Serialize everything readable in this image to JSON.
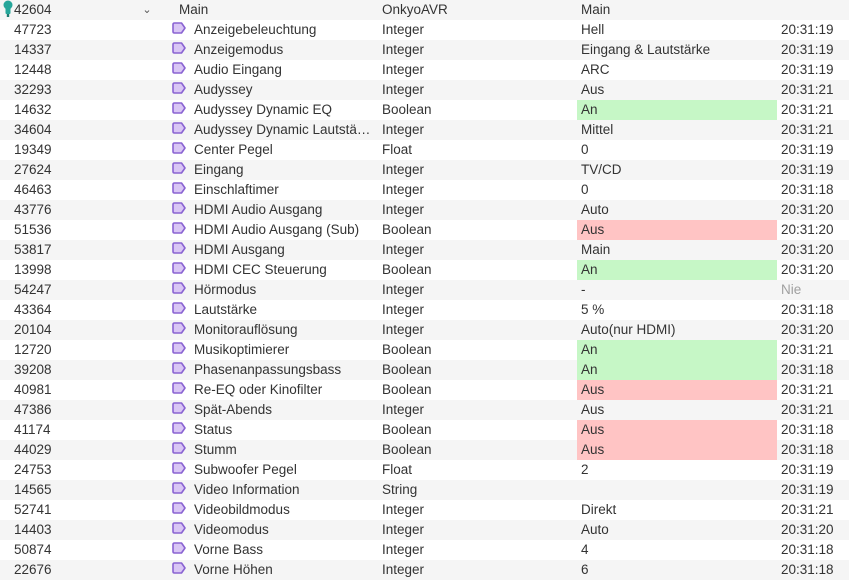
{
  "colors": {
    "accent": "#8a63d2",
    "true_bg": "#c6f7c6",
    "false_bg": "#ffc4c4",
    "instance_icon": "#26a69a"
  },
  "icons": {
    "expander": "chevron-down-icon",
    "instance": "instance-icon",
    "variable": "variable-icon"
  },
  "parent": {
    "id": "42604",
    "expander_glyph": "⌄",
    "name": "Main",
    "type": "OnkyoAVR",
    "value": "Main"
  },
  "rows": [
    {
      "id": "47723",
      "name": "Anzeigebeleuchtung",
      "type": "Integer",
      "value": "Hell",
      "status": "",
      "time": "20:31:19"
    },
    {
      "id": "14337",
      "name": "Anzeigemodus",
      "type": "Integer",
      "value": "Eingang & Lautstärke",
      "status": "",
      "time": "20:31:19"
    },
    {
      "id": "12448",
      "name": "Audio Eingang",
      "type": "Integer",
      "value": "ARC",
      "status": "",
      "time": "20:31:19"
    },
    {
      "id": "32293",
      "name": "Audyssey",
      "type": "Integer",
      "value": "Aus",
      "status": "",
      "time": "20:31:21"
    },
    {
      "id": "14632",
      "name": "Audyssey Dynamic EQ",
      "type": "Boolean",
      "value": "An",
      "status": "green",
      "time": "20:31:21"
    },
    {
      "id": "34604",
      "name": "Audyssey Dynamic Lautstä…",
      "type": "Integer",
      "value": "Mittel",
      "status": "",
      "time": "20:31:21"
    },
    {
      "id": "19349",
      "name": "Center Pegel",
      "type": "Float",
      "value": "0",
      "status": "",
      "time": "20:31:19"
    },
    {
      "id": "27624",
      "name": "Eingang",
      "type": "Integer",
      "value": "TV/CD",
      "status": "",
      "time": "20:31:19"
    },
    {
      "id": "46463",
      "name": "Einschlaftimer",
      "type": "Integer",
      "value": "0",
      "status": "",
      "time": "20:31:18"
    },
    {
      "id": "43776",
      "name": "HDMI Audio Ausgang",
      "type": "Integer",
      "value": "Auto",
      "status": "",
      "time": "20:31:20"
    },
    {
      "id": "51536",
      "name": "HDMI Audio Ausgang (Sub)",
      "type": "Boolean",
      "value": "Aus",
      "status": "red",
      "time": "20:31:20"
    },
    {
      "id": "53817",
      "name": "HDMI Ausgang",
      "type": "Integer",
      "value": "Main",
      "status": "",
      "time": "20:31:20"
    },
    {
      "id": "13998",
      "name": "HDMI CEC Steuerung",
      "type": "Boolean",
      "value": "An",
      "status": "green",
      "time": "20:31:20"
    },
    {
      "id": "54247",
      "name": "Hörmodus",
      "type": "Integer",
      "value": "-",
      "status": "",
      "time": "Nie",
      "time_muted": true
    },
    {
      "id": "43364",
      "name": "Lautstärke",
      "type": "Integer",
      "value": "5 %",
      "status": "",
      "time": "20:31:18"
    },
    {
      "id": "20104",
      "name": "Monitorauflösung",
      "type": "Integer",
      "value": "Auto(nur HDMI)",
      "status": "",
      "time": "20:31:20"
    },
    {
      "id": "12720",
      "name": "Musikoptimierer",
      "type": "Boolean",
      "value": "An",
      "status": "green",
      "time": "20:31:21"
    },
    {
      "id": "39208",
      "name": "Phasenanpassungsbass",
      "type": "Boolean",
      "value": "An",
      "status": "green",
      "time": "20:31:18"
    },
    {
      "id": "40981",
      "name": "Re-EQ oder Kinofilter",
      "type": "Boolean",
      "value": "Aus",
      "status": "red",
      "time": "20:31:21"
    },
    {
      "id": "47386",
      "name": "Spät-Abends",
      "type": "Integer",
      "value": "Aus",
      "status": "",
      "time": "20:31:21"
    },
    {
      "id": "41174",
      "name": "Status",
      "type": "Boolean",
      "value": "Aus",
      "status": "red",
      "time": "20:31:18"
    },
    {
      "id": "44029",
      "name": "Stumm",
      "type": "Boolean",
      "value": "Aus",
      "status": "red",
      "time": "20:31:18"
    },
    {
      "id": "24753",
      "name": "Subwoofer Pegel",
      "type": "Float",
      "value": "2",
      "status": "",
      "time": "20:31:19"
    },
    {
      "id": "14565",
      "name": "Video Information",
      "type": "String",
      "value": "",
      "status": "",
      "time": "20:31:19"
    },
    {
      "id": "52741",
      "name": "Videobildmodus",
      "type": "Integer",
      "value": "Direkt",
      "status": "",
      "time": "20:31:21"
    },
    {
      "id": "14403",
      "name": "Videomodus",
      "type": "Integer",
      "value": "Auto",
      "status": "",
      "time": "20:31:20"
    },
    {
      "id": "50874",
      "name": "Vorne Bass",
      "type": "Integer",
      "value": "4",
      "status": "",
      "time": "20:31:18"
    },
    {
      "id": "22676",
      "name": "Vorne Höhen",
      "type": "Integer",
      "value": "6",
      "status": "",
      "time": "20:31:18"
    }
  ]
}
